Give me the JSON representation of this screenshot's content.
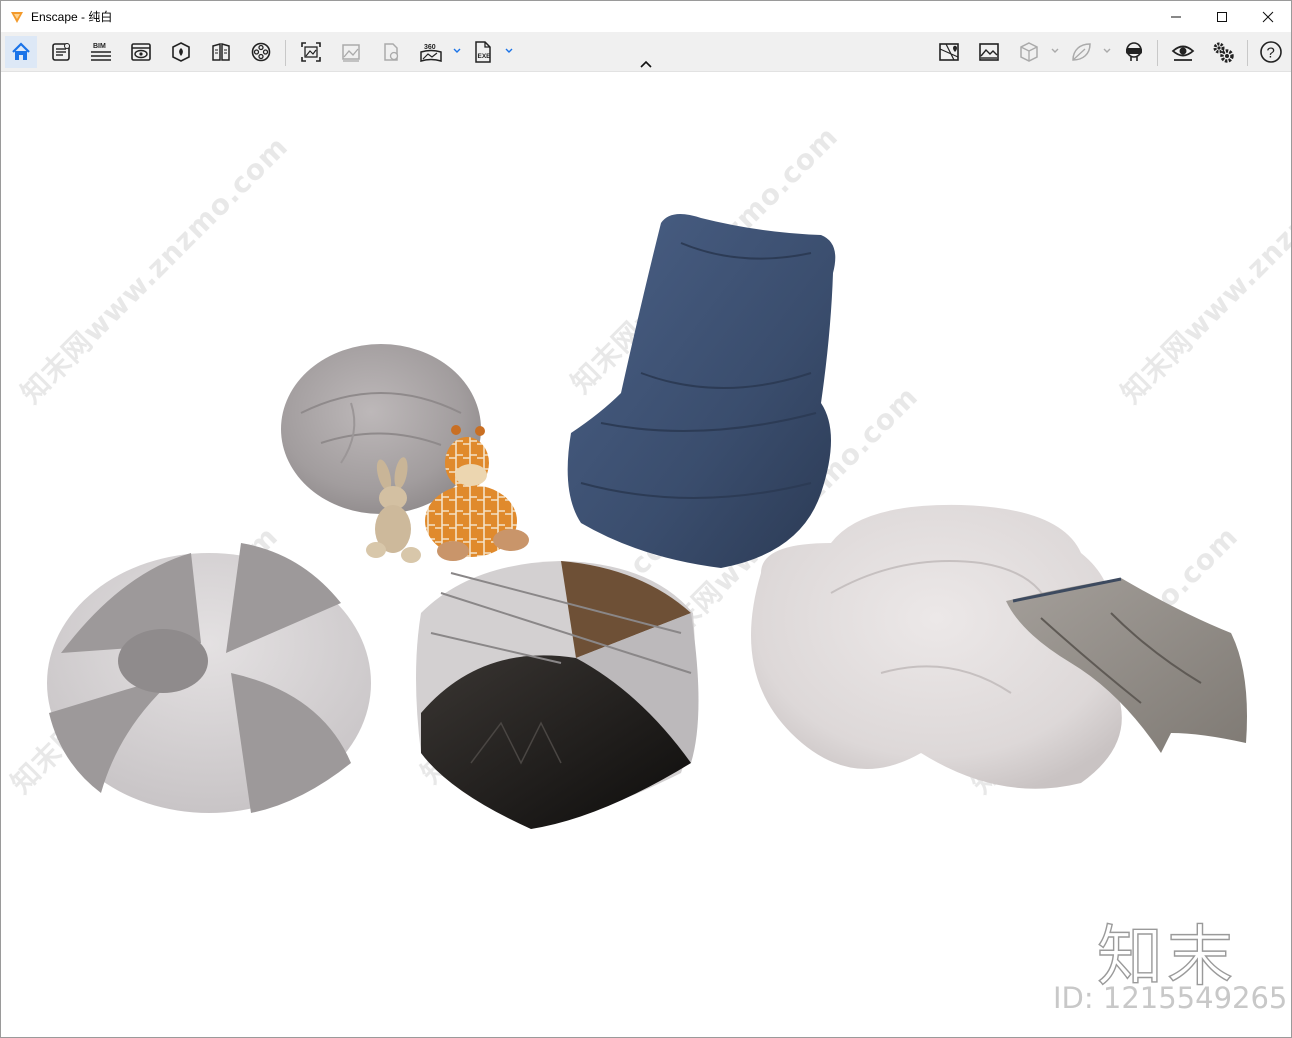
{
  "window": {
    "title": "Enscape - 纯白",
    "controls": {
      "minimize": "—",
      "maximize": "☐",
      "close": "✕"
    }
  },
  "toolbar": {
    "left_buttons": [
      {
        "name": "home-icon",
        "active": true
      },
      {
        "name": "document-settings-icon"
      },
      {
        "name": "bim-icon",
        "label": "BIM"
      },
      {
        "name": "view-icon"
      },
      {
        "name": "asset-library-icon"
      },
      {
        "name": "material-book-icon"
      },
      {
        "name": "video-reel-icon"
      },
      {
        "name": "screenshot-icon"
      },
      {
        "name": "batch-render-icon"
      },
      {
        "name": "upload-icon"
      },
      {
        "name": "panorama-360-icon",
        "label": "360",
        "dropdown": true
      },
      {
        "name": "export-exe-icon",
        "label": "EXE",
        "dropdown": true
      }
    ],
    "right_buttons": [
      {
        "name": "map-pin-icon"
      },
      {
        "name": "image-export-icon"
      },
      {
        "name": "cube-icon",
        "dropdown": true
      },
      {
        "name": "leaf-icon",
        "dropdown": true
      },
      {
        "name": "vr-headset-icon"
      },
      {
        "name": "eye-icon"
      },
      {
        "name": "gears-icon"
      },
      {
        "name": "help-icon",
        "label": "?"
      }
    ]
  },
  "viewport": {
    "watermarks": [
      "知末网www.znzmo.com",
      "知末网www.znzmo.com",
      "知末网www.znzmo.com",
      "知末网www.znzmo.com",
      "知末网www.znzmo.com",
      "知末网www.znzmo.com",
      "知末网www.znzmo.com"
    ],
    "brand": {
      "logo": "知末",
      "id": "ID: 1215549265"
    },
    "objects": [
      "grey-beanbag",
      "stuffed-rabbit",
      "stuffed-giraffe",
      "blue-beanbag-chair",
      "striped-beanbag",
      "patchwork-pouf",
      "cloud-floor-cushion",
      "knit-throw-blanket"
    ],
    "colors": {
      "grey": "#a9a4a5",
      "blue": "#3e5271",
      "cloud": "#e1dcdc",
      "dark": "#1b1918",
      "accent": "#f39a2b"
    }
  }
}
